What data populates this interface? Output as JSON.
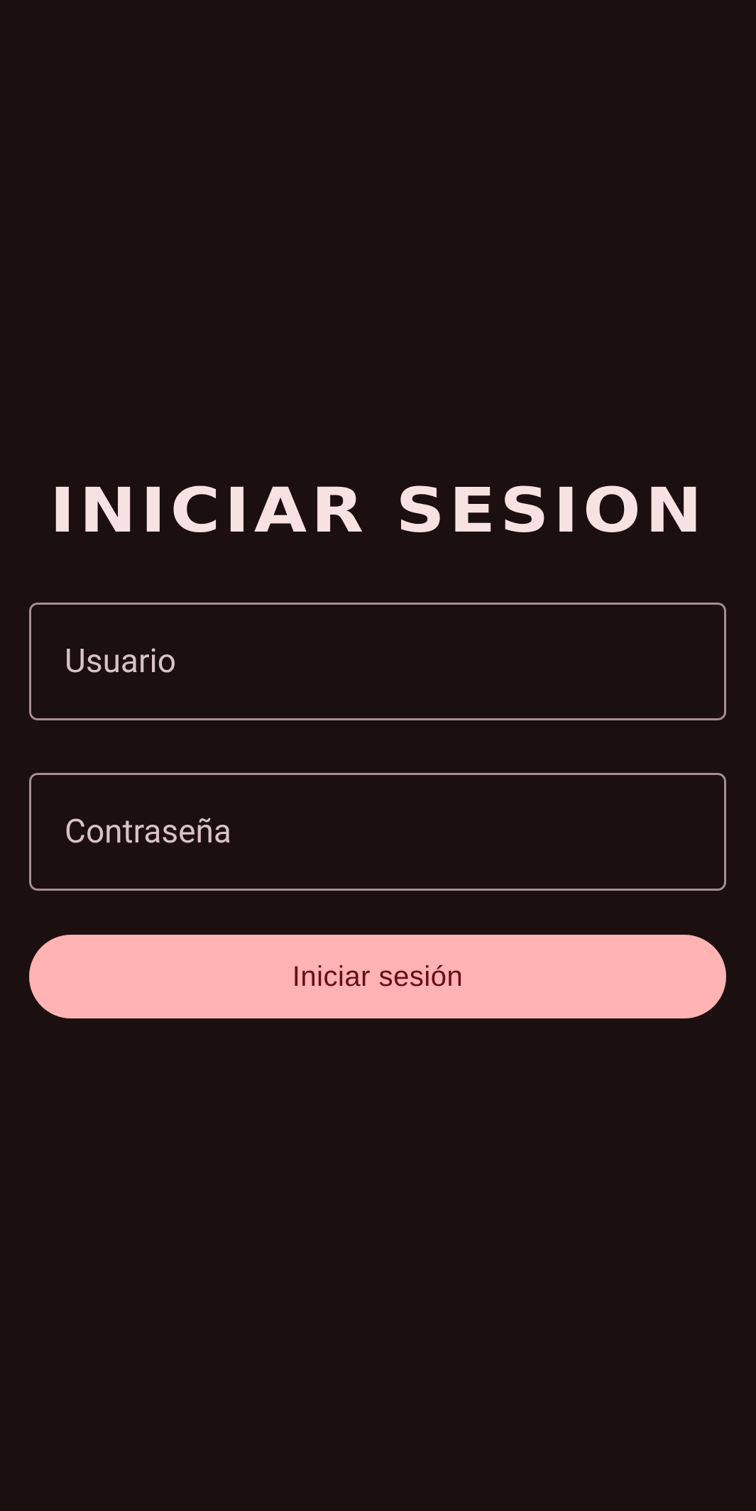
{
  "login": {
    "title": "INICIAR SESION",
    "username_placeholder": "Usuario",
    "password_placeholder": "Contraseña",
    "submit_label": "Iniciar sesión"
  },
  "colors": {
    "background": "#1c0f0f",
    "title": "#f7e1e1",
    "field_border": "#a58f8f",
    "field_text": "#d8c2c2",
    "button_background": "#ffb3b2",
    "button_text": "#680d16"
  }
}
